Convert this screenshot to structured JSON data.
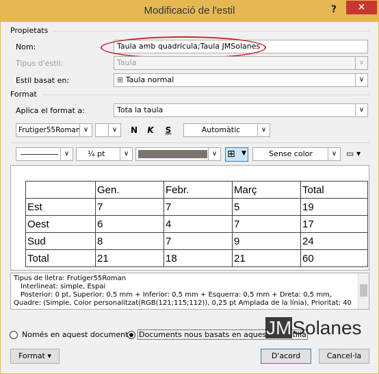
{
  "window": {
    "title": "Modificació de l'estil",
    "help": "?",
    "close": "✕"
  },
  "properties": {
    "header": "Propietats",
    "name_label": "Nom:",
    "name_value": "Taula amb quadrícula;Taula JMSolanes",
    "type_label": "Tipus d'estil:",
    "type_value": "Taula",
    "based_label": "Estil basat en:",
    "based_value": "Taula normal"
  },
  "format": {
    "header": "Format",
    "apply_label": "Aplica el format a:",
    "apply_value": "Tota la taula",
    "font": "Frutiger55Roman",
    "size": "",
    "bold": "N",
    "italic": "K",
    "underline": "S",
    "color": "Automàtic",
    "line_width": "¼ pt",
    "fill": "Sense color",
    "border_color": "#7c7370"
  },
  "preview_table": {
    "rows": [
      [
        "",
        "Gen.",
        "Febr.",
        "Març",
        "Total"
      ],
      [
        "Est",
        "7",
        "7",
        "5",
        "19"
      ],
      [
        "Oest",
        "6",
        "4",
        "7",
        "17"
      ],
      [
        "Sud",
        "8",
        "7",
        "9",
        "24"
      ],
      [
        "Total",
        "21",
        "18",
        "21",
        "60"
      ]
    ]
  },
  "description": {
    "line1": "Tipus de lletra: Frutiger55Roman",
    "line2": "Interlineat:  simple, Espai",
    "line3": "Posterior:  0 pt, Superior:  0,5 mm + Inferior:  0,5 mm + Esquerra:  0,5 mm + Dreta:  0,5 mm,",
    "line4": "Quadre: (Simple, Color personalitzat(RGB(121;115;112)),  0,25 pt Amplada de la línia), Prioritat: 40"
  },
  "options": {
    "only_doc": "Només en aquest document",
    "new_docs": "Documents nous basats en aquesta plantilla"
  },
  "buttons": {
    "format": "Format ▾",
    "ok": "D'acord",
    "cancel": "Cancel·la"
  },
  "logo": {
    "prefix": "JM",
    "suffix": "Solanes"
  },
  "colors": {
    "titlebar": "#e6b854",
    "close": "#c7372f",
    "highlight": "#c0292a"
  }
}
